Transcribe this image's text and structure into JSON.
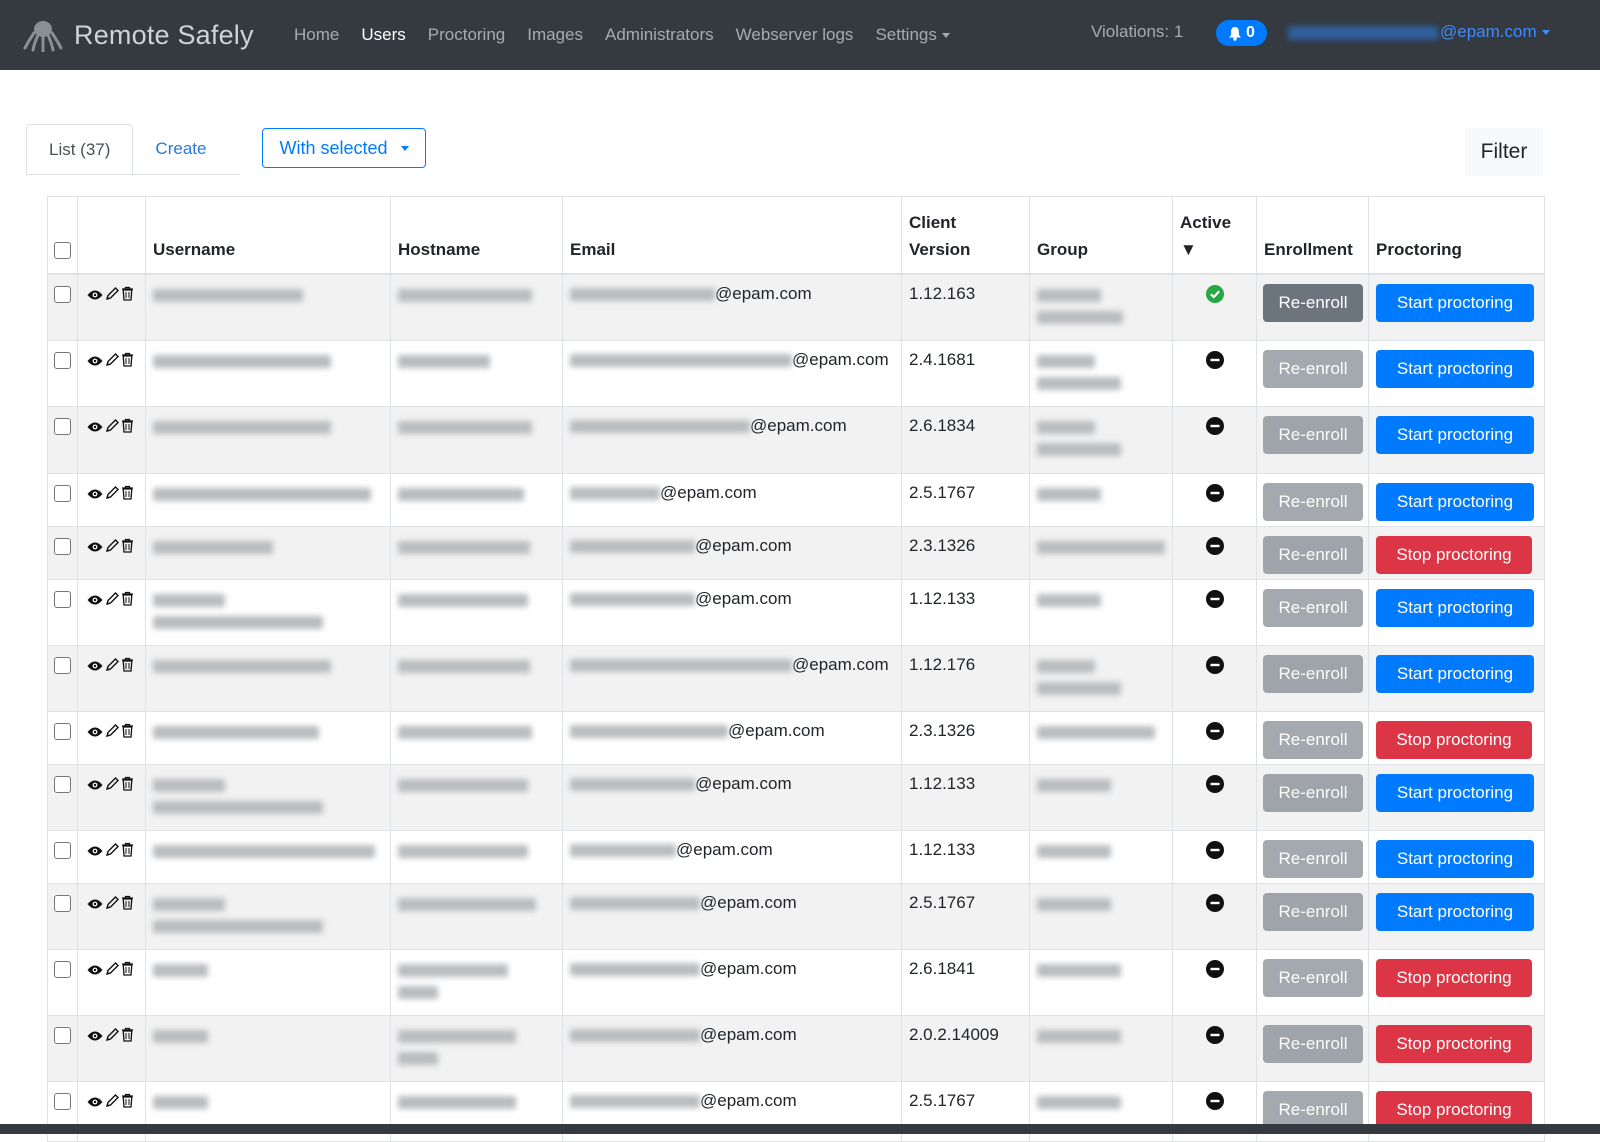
{
  "brand": {
    "name": "Remote Safely",
    "logo_icon": "octopus-logo-icon"
  },
  "nav": {
    "items": [
      {
        "label": "Home",
        "active": false
      },
      {
        "label": "Users",
        "active": true
      },
      {
        "label": "Proctoring",
        "active": false
      },
      {
        "label": "Images",
        "active": false
      },
      {
        "label": "Administrators",
        "active": false
      },
      {
        "label": "Webserver logs",
        "active": false
      },
      {
        "label": "Settings",
        "active": false,
        "dropdown": true
      }
    ],
    "violations": "Violations: 1",
    "notifications": {
      "count": "0",
      "icon": "bell-icon"
    },
    "user_email_suffix": "@epam.com"
  },
  "toolbar": {
    "tab_list": "List (37)",
    "tab_create": "Create",
    "with_selected": "With selected",
    "filter": "Filter"
  },
  "table": {
    "headers": {
      "username": "Username",
      "hostname": "Hostname",
      "email": "Email",
      "client_version_1": "Client",
      "client_version_2": "Version",
      "group": "Group",
      "active": "Active",
      "active_sort": "▼",
      "enrollment": "Enrollment",
      "proctoring": "Proctoring"
    },
    "reenroll_label": "Re-enroll",
    "rows": [
      {
        "email": "@epam.com",
        "version": "1.12.163",
        "active": true,
        "reenroll_enabled": true,
        "proctoring": "Start proctoring"
      },
      {
        "email": "@epam.com",
        "version": "2.4.1681",
        "active": false,
        "reenroll_enabled": false,
        "proctoring": "Start proctoring"
      },
      {
        "email": "@epam.com",
        "version": "2.6.1834",
        "active": false,
        "reenroll_enabled": false,
        "proctoring": "Start proctoring"
      },
      {
        "email": "@epam.com",
        "version": "2.5.1767",
        "active": false,
        "reenroll_enabled": false,
        "proctoring": "Start proctoring"
      },
      {
        "email": "@epam.com",
        "version": "2.3.1326",
        "active": false,
        "reenroll_enabled": false,
        "proctoring": "Stop proctoring"
      },
      {
        "email": "@epam.com",
        "version": "1.12.133",
        "active": false,
        "reenroll_enabled": false,
        "proctoring": "Start proctoring"
      },
      {
        "email": "@epam.com",
        "version": "1.12.176",
        "active": false,
        "reenroll_enabled": false,
        "proctoring": "Start proctoring"
      },
      {
        "email": "@epam.com",
        "version": "2.3.1326",
        "active": false,
        "reenroll_enabled": false,
        "proctoring": "Stop proctoring"
      },
      {
        "email": "@epam.com",
        "version": "1.12.133",
        "active": false,
        "reenroll_enabled": false,
        "proctoring": "Start proctoring"
      },
      {
        "email": "@epam.com",
        "version": "1.12.133",
        "active": false,
        "reenroll_enabled": false,
        "proctoring": "Start proctoring"
      },
      {
        "email": "@epam.com",
        "version": "2.5.1767",
        "active": false,
        "reenroll_enabled": false,
        "proctoring": "Start proctoring"
      },
      {
        "email": "@epam.com",
        "version": "2.6.1841",
        "active": false,
        "reenroll_enabled": false,
        "proctoring": "Stop proctoring"
      },
      {
        "email": "@epam.com",
        "version": "2.0.2.14009",
        "active": false,
        "reenroll_enabled": false,
        "proctoring": "Stop proctoring"
      },
      {
        "email": "@epam.com",
        "version": "2.5.1767",
        "active": false,
        "reenroll_enabled": false,
        "proctoring": "Stop proctoring"
      }
    ]
  },
  "colors": {
    "navbar": "#343a40",
    "primary": "#007bff",
    "danger": "#dc3545",
    "secondary": "#6c757d",
    "success": "#28a745"
  }
}
